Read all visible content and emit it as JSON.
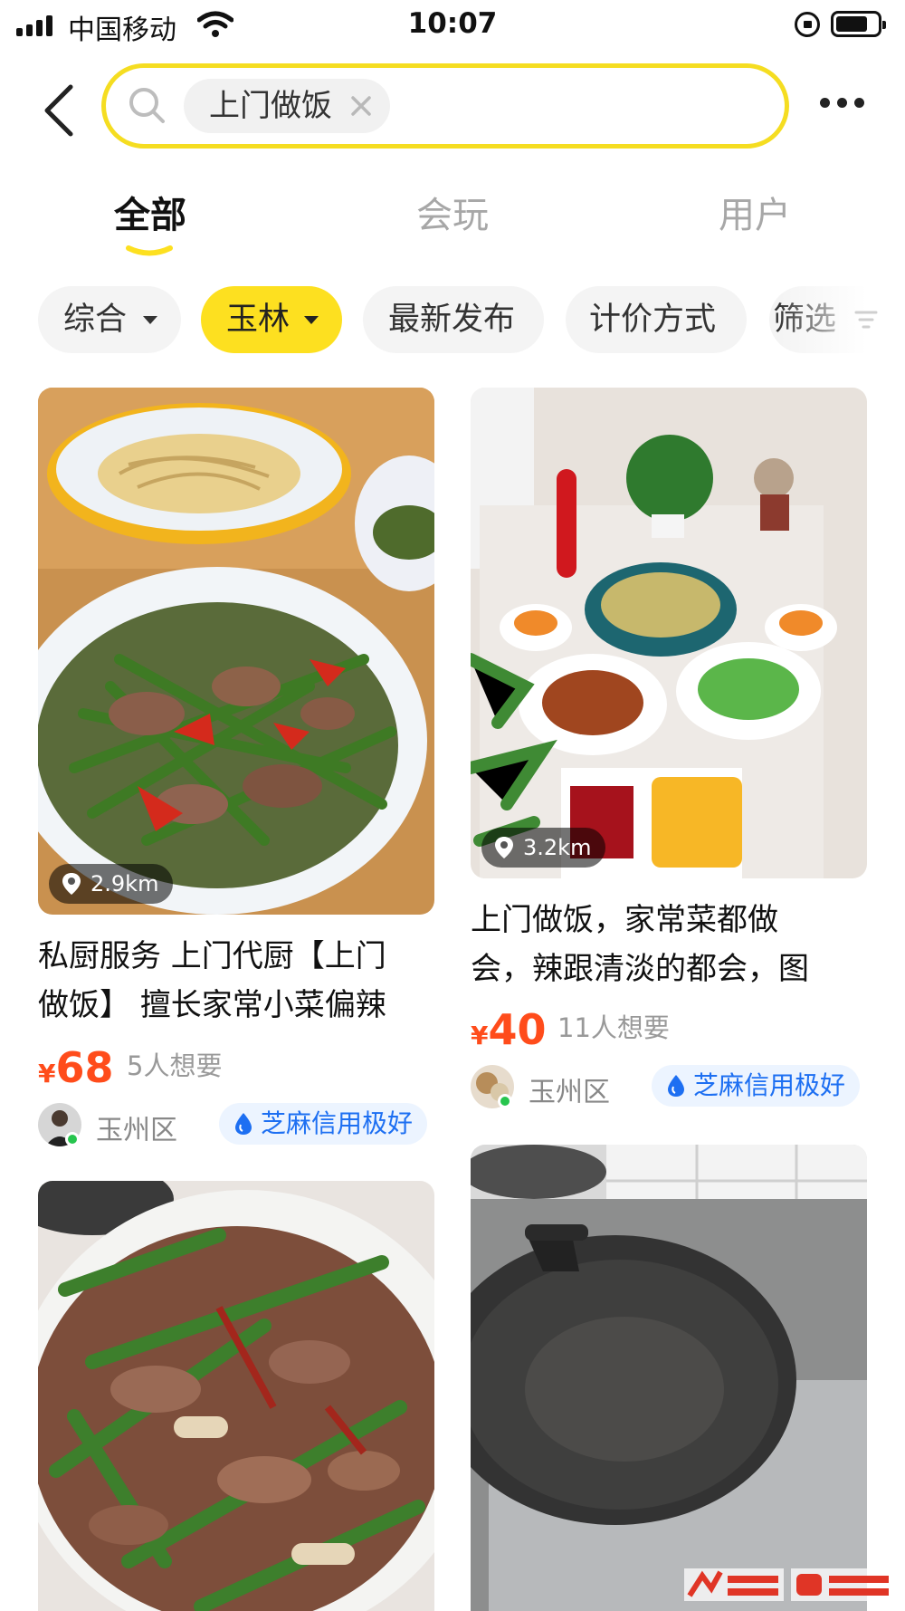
{
  "status_bar": {
    "carrier": "中国移动",
    "time": "10:07"
  },
  "search": {
    "query": "上门做饭"
  },
  "tabs": [
    {
      "label": "全部",
      "active": true
    },
    {
      "label": "会玩",
      "active": false
    },
    {
      "label": "用户",
      "active": false
    }
  ],
  "filters": [
    {
      "label": "综合",
      "dropdown": true,
      "active": false
    },
    {
      "label": "玉林",
      "dropdown": true,
      "active": true
    },
    {
      "label": "最新发布",
      "dropdown": false,
      "active": false
    },
    {
      "label": "计价方式",
      "dropdown": false,
      "active": false
    },
    {
      "label": "筛选",
      "dropdown": false,
      "active": false
    }
  ],
  "listings": [
    {
      "distance": "2.9km",
      "title_line1": "私厨服务 上门代厨【上门",
      "title_line2": "做饭】 擅长家常小菜偏辣",
      "price_symbol": "¥",
      "price": "68",
      "wants": "5人想要",
      "area": "玉州区",
      "credit_badge": "芝麻信用极好",
      "image_icon": "stir-fry-photo"
    },
    {
      "distance": "3.2km",
      "title_line1": "上门做饭，家常菜都做",
      "title_line2": "会，辣跟清淡的都会，图",
      "price_symbol": "¥",
      "price": "40",
      "wants": "11人想要",
      "area": "玉州区",
      "credit_badge": "芝麻信用极好",
      "image_icon": "dining-table-photo"
    },
    {
      "image_icon": "meat-dish-photo"
    },
    {
      "image_icon": "wok-photo"
    }
  ],
  "colors": {
    "accent_yellow": "#fde020",
    "price_red": "#ff4c1b",
    "credit_blue": "#1d6ff2"
  }
}
